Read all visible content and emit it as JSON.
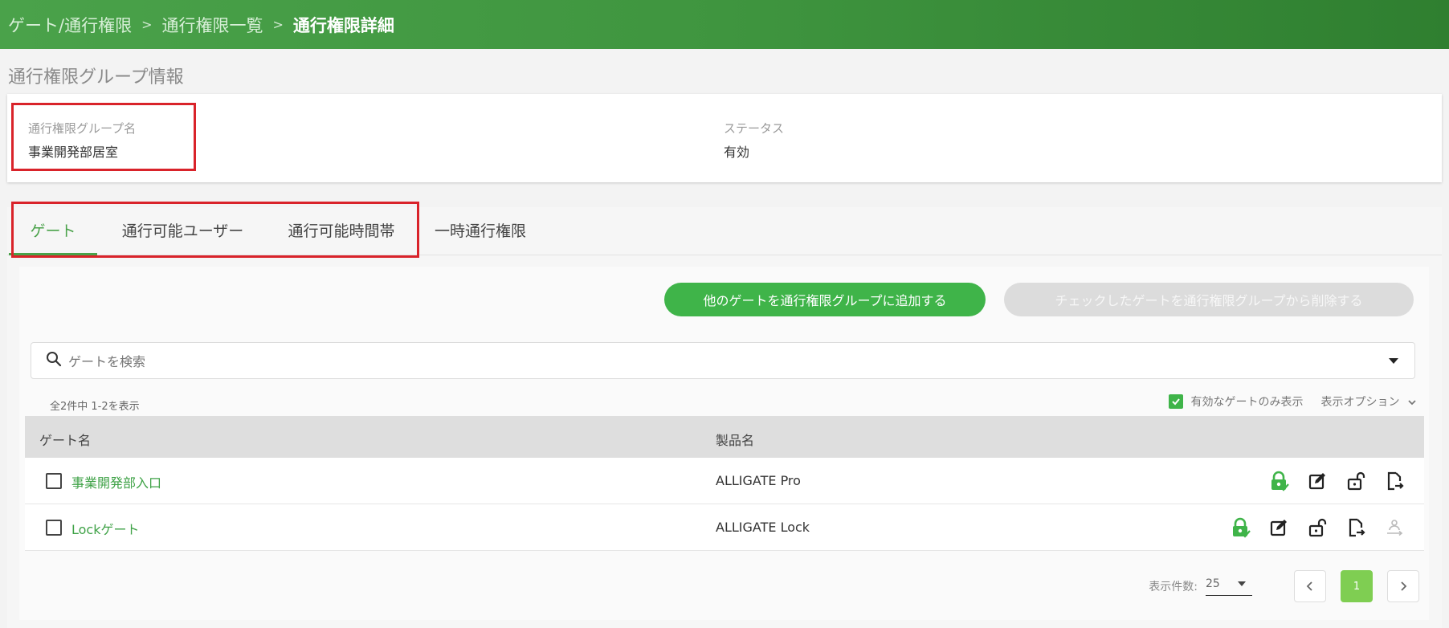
{
  "breadcrumb": {
    "items": [
      "ゲート/通行権限",
      "通行権限一覧"
    ],
    "current": "通行権限詳細",
    "separator": ">"
  },
  "section_title": "通行権限グループ情報",
  "group_info": {
    "name_label": "通行権限グループ名",
    "name_value": "事業開発部居室",
    "status_label": "ステータス",
    "status_value": "有効"
  },
  "tabs": [
    {
      "label": "ゲート",
      "active": true
    },
    {
      "label": "通行可能ユーザー",
      "active": false
    },
    {
      "label": "通行可能時間帯",
      "active": false
    },
    {
      "label": "一時通行権限",
      "active": false
    }
  ],
  "buttons": {
    "add": "他のゲートを通行権限グループに追加する",
    "remove": "チェックしたゲートを通行権限グループから削除する"
  },
  "search": {
    "placeholder": "ゲートを検索"
  },
  "count_text": "全2件中 1-2を表示",
  "filter": {
    "active_only_label": "有効なゲートのみ表示",
    "active_only_checked": true,
    "display_options_label": "表示オプション"
  },
  "table": {
    "headers": [
      "ゲート名",
      "製品名"
    ],
    "rows": [
      {
        "gate": "事業開発部入口",
        "product": "ALLIGATE Pro",
        "actions": [
          "lock-check-icon",
          "edit-icon",
          "unlock-icon",
          "export-icon"
        ]
      },
      {
        "gate": "Lockゲート",
        "product": "ALLIGATE Lock",
        "actions": [
          "lock-check-icon",
          "edit-icon",
          "unlock-icon",
          "export-icon",
          "person-transfer-icon"
        ]
      }
    ]
  },
  "pagination": {
    "page_size_label": "表示件数:",
    "page_size": "25",
    "current_page": "1"
  },
  "colors": {
    "brand_green": "#3fb449",
    "header_gradient_start": "#4aa24a",
    "header_gradient_end": "#2f7f30",
    "highlight_red": "#d9232a",
    "link_green": "#3fa247"
  }
}
